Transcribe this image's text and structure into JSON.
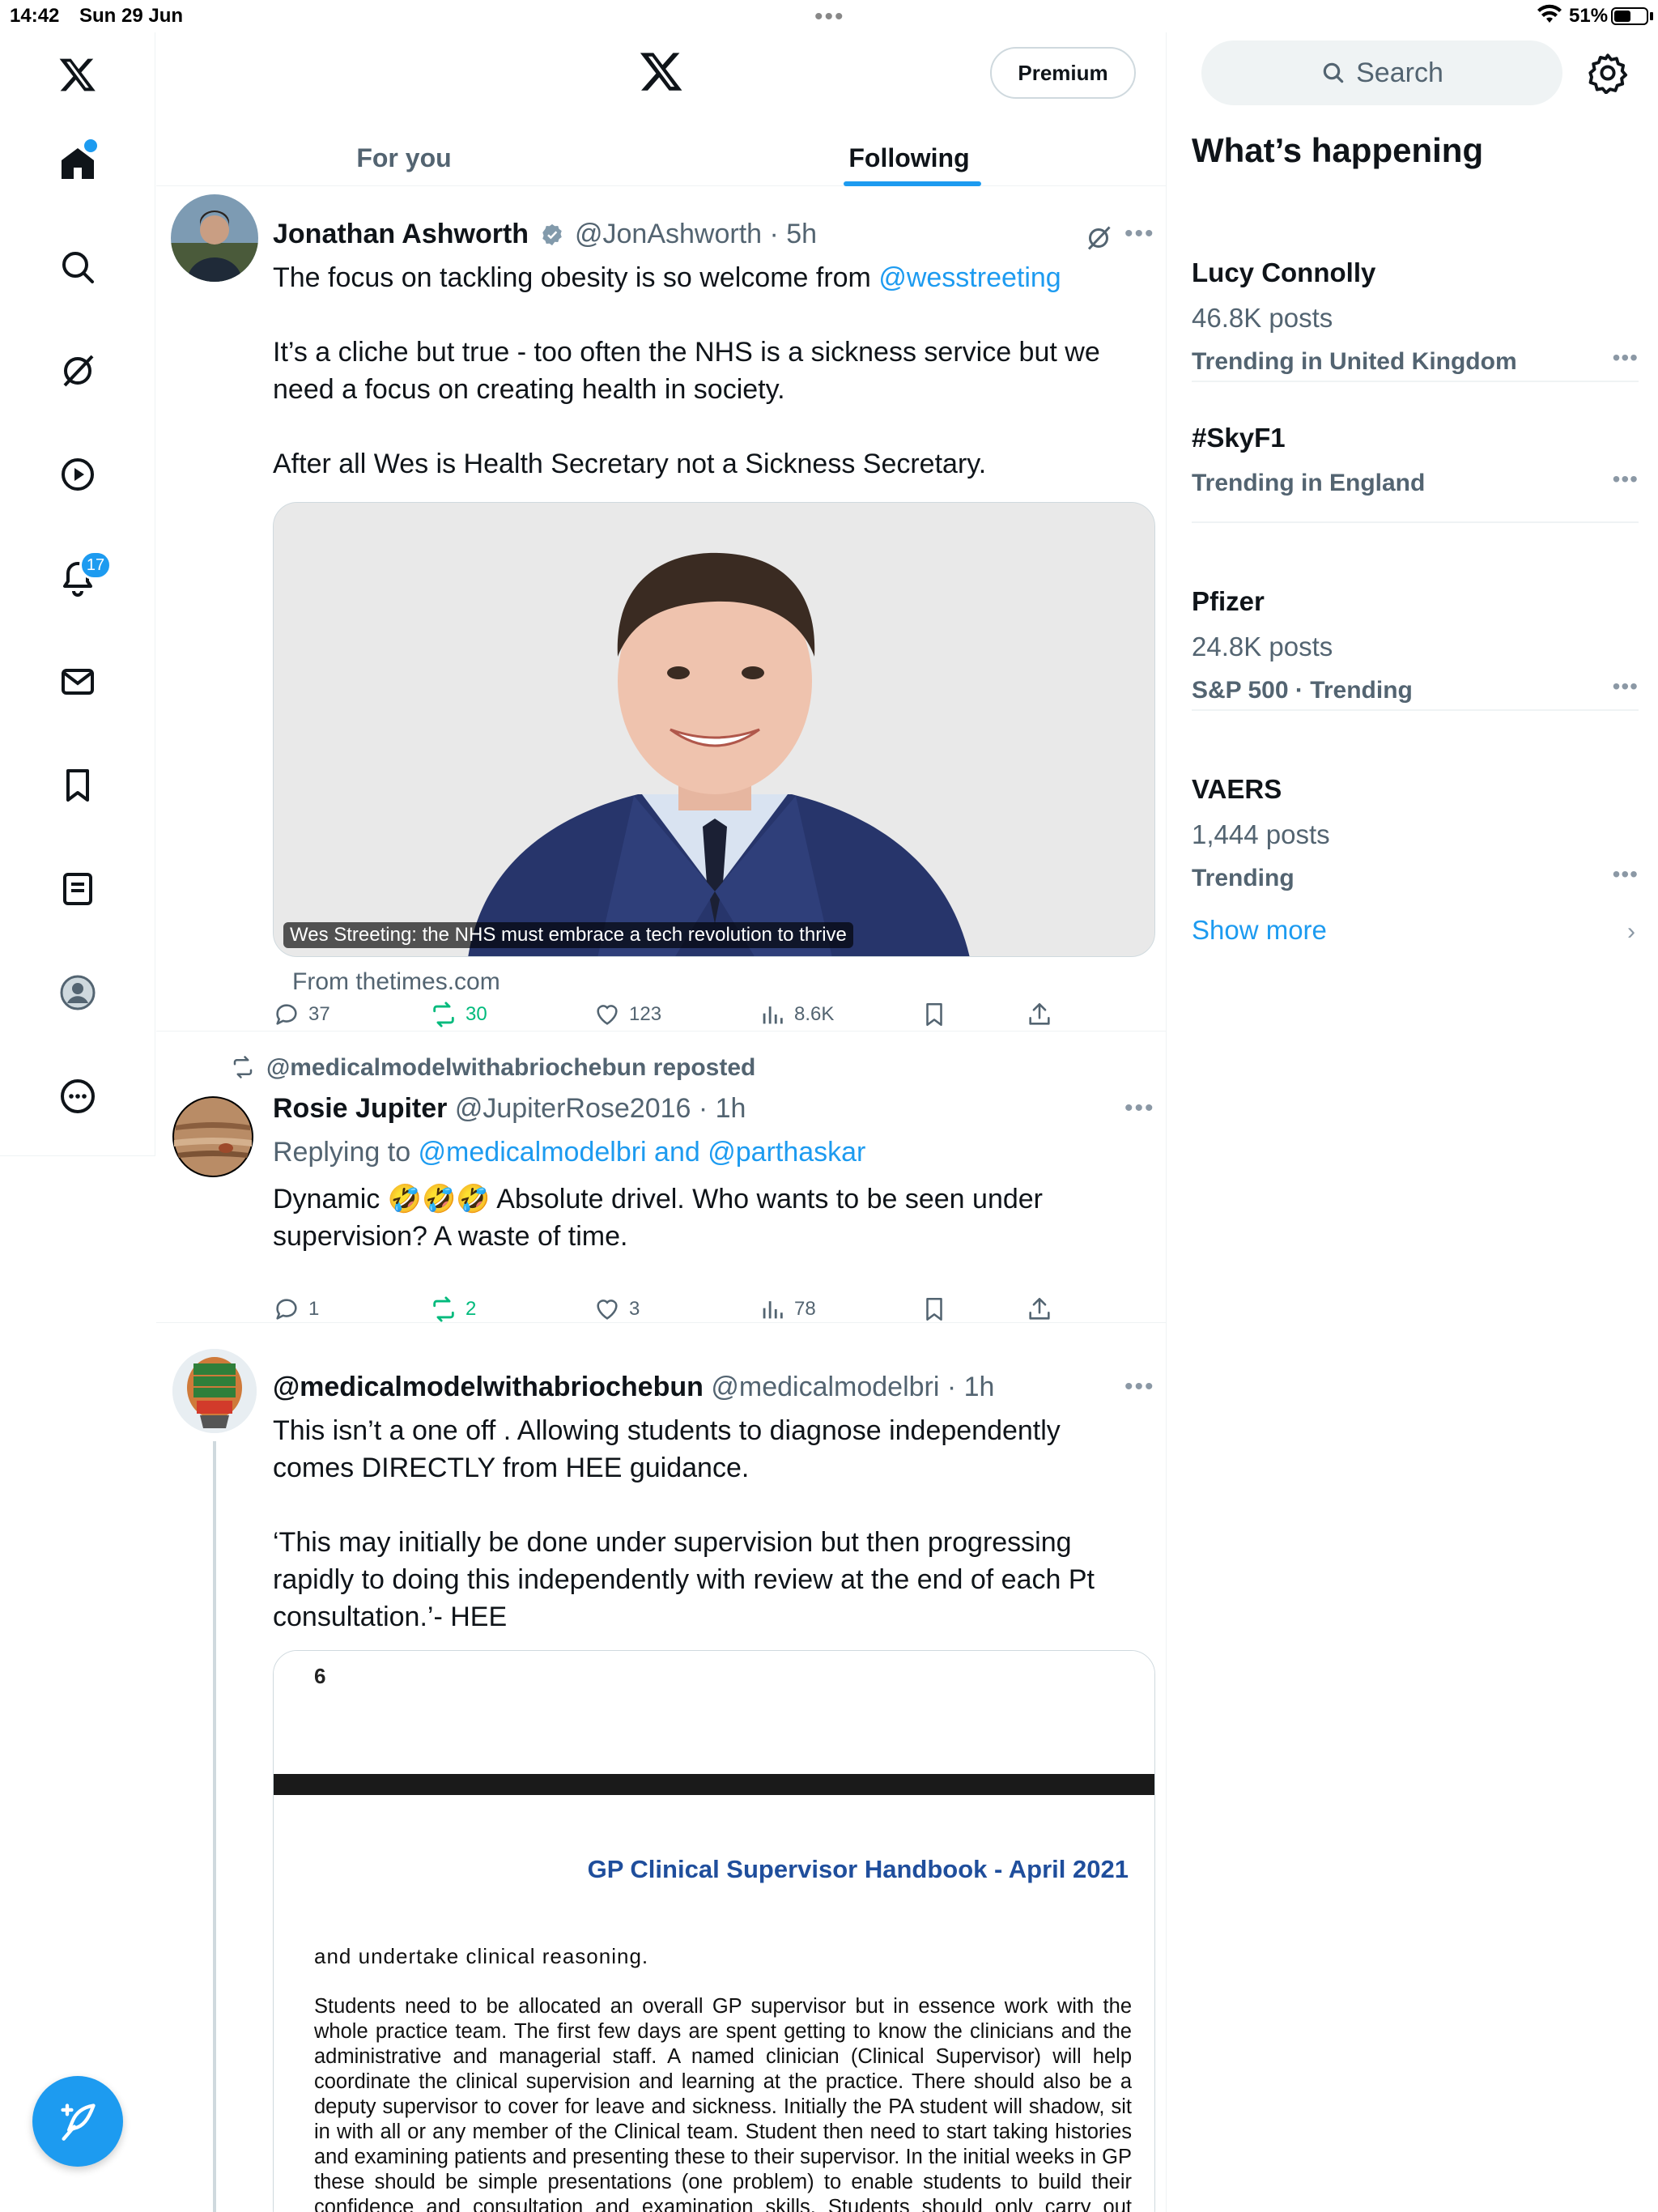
{
  "status_bar": {
    "time": "14:42",
    "date": "Sun 29 Jun",
    "battery": "51%"
  },
  "left_nav": {
    "notifications_badge": "17",
    "items": [
      "x-logo",
      "home",
      "search",
      "grok",
      "video",
      "notifications",
      "messages",
      "bookmarks",
      "lists",
      "profile",
      "more"
    ]
  },
  "header": {
    "premium_label": "Premium",
    "tabs": [
      {
        "label": "For you"
      },
      {
        "label": "Following"
      }
    ]
  },
  "posts": [
    {
      "name": "Jonathan Ashworth",
      "handle": "@JonAshworth",
      "time": "5h",
      "body_line1_prefix": "The focus on tackling obesity is so welcome from ",
      "body_mention": "@wesstreeting",
      "body_para2": "It’s a cliche but true - too often the NHS is a sickness service but we need a focus on creating health in society.",
      "body_para3": "After all Wes is Health Secretary not a Sickness Secretary.",
      "card_caption": "Wes Streeting: the NHS must embrace a tech revolution to thrive",
      "card_source": "From thetimes.com",
      "replies": "37",
      "reposts": "30",
      "likes": "123",
      "views": "8.6K"
    },
    {
      "reposted_by": "@medicalmodelwithabriochebun reposted",
      "name": "Rosie Jupiter",
      "handle": "@JupiterRose2016",
      "time": "1h",
      "replying_prefix": "Replying to ",
      "replying_to": "@medicalmodelbri and @parthaskar",
      "body": "Dynamic 🤣🤣🤣 Absolute drivel. Who wants to be seen under supervision? A waste of time.",
      "replies": "1",
      "reposts": "2",
      "likes": "3",
      "views": "78"
    },
    {
      "name": "@medicalmodelwithabriochebun",
      "handle": "@medicalmodelbri",
      "time": "1h",
      "body_para1": "This isn’t a one off . Allowing students to diagnose independently comes DIRECTLY from HEE guidance.",
      "body_para2": "‘This may initially be done under supervision but then progressing rapidly to doing this independently with review at the end of each Pt consultation.’- HEE",
      "doc": {
        "page_number": "6",
        "title": "GP Clinical Supervisor Handbook - April 2021",
        "subtitle": "and undertake clinical reasoning.",
        "paragraph": "Students need to be allocated an overall GP supervisor but in essence work with the whole practice team. The first few days are spent getting to know the clinicians and the administrative and managerial staff. A named clinician (Clinical Supervisor) will help coordinate the clinical supervision and learning at the practice. There should also be a deputy supervisor to cover for leave and sickness. Initially the PA student will shadow, sit in with all or any member of the Clinical team. Student then need to start taking histories and examining patients and presenting these to their supervisor. In the initial weeks in GP these should be simple presentations (one problem) to enable students to build their confidence and consultation and examination skills. Students should only carry out examinations that they have been taught at"
      }
    }
  ],
  "sidebar": {
    "search_placeholder": "Search",
    "title": "What’s happening",
    "trends": [
      {
        "name": "Lucy Connolly",
        "posts": "46.8K posts",
        "context": "Trending in United Kingdom"
      },
      {
        "name": "#SkyF1",
        "posts": "",
        "context": "Trending in England"
      },
      {
        "name": "Pfizer",
        "posts": "24.8K posts",
        "context": "S&P 500 · Trending"
      },
      {
        "name": "VAERS",
        "posts": "1,444 posts",
        "context": "Trending"
      }
    ],
    "show_more": "Show more"
  },
  "colors": {
    "accent": "#1d9bf0",
    "repost_green": "#00ba7c",
    "muted": "#536471"
  }
}
